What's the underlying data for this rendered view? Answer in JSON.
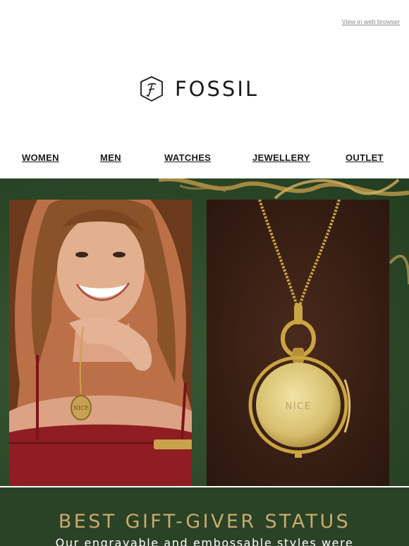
{
  "header": {
    "web_link": "View in web browser",
    "brand": "FOSSIL"
  },
  "nav": {
    "items": [
      {
        "label": "WOMEN"
      },
      {
        "label": "MEN"
      },
      {
        "label": "WATCHES"
      },
      {
        "label": "JEWELLERY"
      },
      {
        "label": "OUTLET"
      }
    ]
  },
  "hero": {
    "engraving_left": "NICE",
    "engraving_right": "NICE"
  },
  "promo": {
    "headline": "BEST GIFT-GIVER STATUS",
    "subline": "Our engravable and embossable styles were"
  },
  "colors": {
    "hero_green": "#2c4828",
    "gold": "#c8ab6e",
    "band_green": "#2a4225"
  }
}
